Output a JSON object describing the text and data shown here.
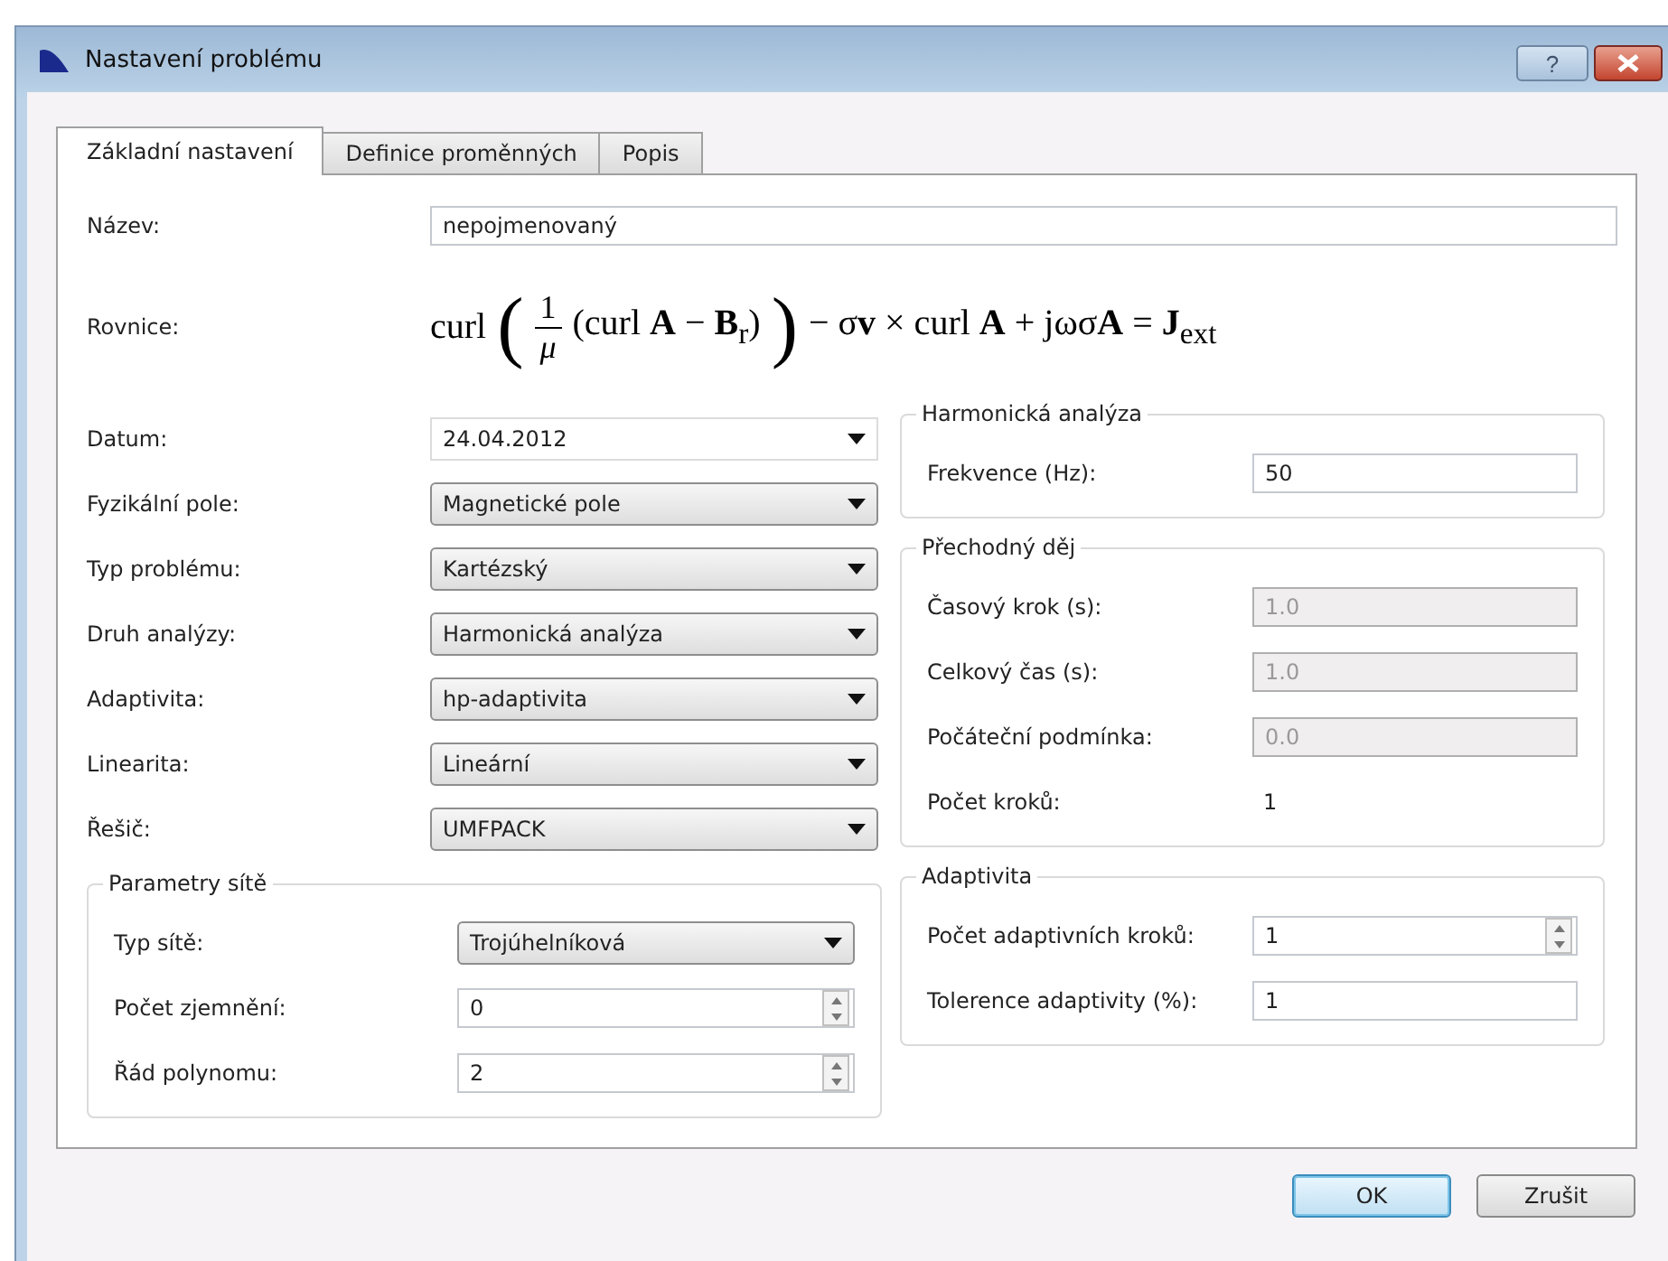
{
  "window": {
    "title": "Nastavení problému",
    "help_button": "?"
  },
  "tabs": [
    {
      "label": "Základní nastavení",
      "selected": true
    },
    {
      "label": "Definice proměnných",
      "selected": false
    },
    {
      "label": "Popis",
      "selected": false
    }
  ],
  "name_field": {
    "label": "Název:",
    "value": "nepojmenovaný"
  },
  "equation": {
    "label": "Rovnice:",
    "lead": "curl",
    "open": "(",
    "close": ")",
    "numerator": "1",
    "denominator": "μ",
    "inner": "(curl **A** − **B**$_{r}$)",
    "tail": "− σ**v** × curl **A** + jωσ**A** = **J**$_{ext}$"
  },
  "settings": [
    {
      "label": "Datum:",
      "kind": "date",
      "value": "24.04.2012"
    },
    {
      "label": "Fyzikální pole:",
      "kind": "combo",
      "value": "Magnetické pole"
    },
    {
      "label": "Typ problému:",
      "kind": "combo",
      "value": "Kartézský"
    },
    {
      "label": "Druh analýzy:",
      "kind": "combo",
      "value": "Harmonická analýza"
    },
    {
      "label": "Adaptivita:",
      "kind": "combo",
      "value": "hp-adaptivita"
    },
    {
      "label": "Linearita:",
      "kind": "combo",
      "value": "Lineární"
    },
    {
      "label": "Řešič:",
      "kind": "combo",
      "value": "UMFPACK"
    }
  ],
  "groups_left": [
    {
      "title": "Parametry sítě",
      "rows": [
        {
          "label": "Typ sítě:",
          "kind": "combo",
          "value": "Trojúhelníková",
          "disabled": false
        },
        {
          "label": "Počet zjemnění:",
          "kind": "spin",
          "value": "0",
          "disabled": false
        },
        {
          "label": "Řád polynomu:",
          "kind": "spin",
          "value": "2",
          "disabled": false
        }
      ]
    }
  ],
  "groups_right": [
    {
      "title": "Harmonická analýza",
      "rows": [
        {
          "label": "Frekvence (Hz):",
          "kind": "input",
          "value": "50",
          "disabled": false
        }
      ]
    },
    {
      "title": "Přechodný děj",
      "rows": [
        {
          "label": "Časový krok (s):",
          "kind": "input",
          "value": "1.0",
          "disabled": true
        },
        {
          "label": "Celkový čas (s):",
          "kind": "input",
          "value": "1.0",
          "disabled": true
        },
        {
          "label": "Počáteční podmínka:",
          "kind": "input",
          "value": "0.0",
          "disabled": true
        },
        {
          "label": "Počet kroků:",
          "kind": "value",
          "value": "1",
          "disabled": false
        }
      ]
    },
    {
      "title": "Adaptivita",
      "rows": [
        {
          "label": "Počet adaptivních kroků:",
          "kind": "spin",
          "value": "1",
          "disabled": false
        },
        {
          "label": "Tolerence adaptivity (%):",
          "kind": "input",
          "value": "1",
          "disabled": false
        }
      ]
    }
  ],
  "buttons": [
    {
      "label": "OK",
      "default": true
    },
    {
      "label": "Zrušit",
      "default": false
    }
  ]
}
